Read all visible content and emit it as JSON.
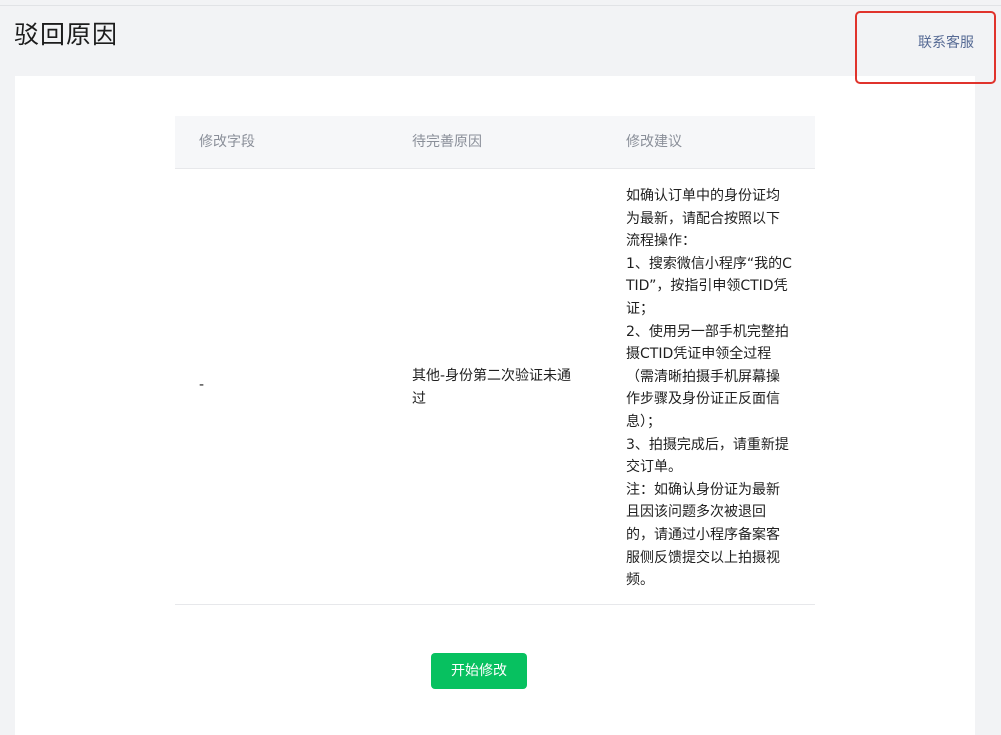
{
  "header": {
    "title": "驳回原因",
    "contact_link": "联系客服"
  },
  "table": {
    "columns": [
      "修改字段",
      "待完善原因",
      "修改建议"
    ],
    "rows": [
      {
        "field": "-",
        "reason_lines": [
          "其他-身份第二次验证未通",
          "过"
        ],
        "suggestion_lines": [
          "如确认订单中的身份证均",
          "为最新，请配合按照以下",
          "流程操作：",
          "1、搜索微信小程序“我的C",
          "TID”，按指引申领CTID凭",
          "证；",
          "2、使用另一部手机完整拍",
          "摄CTID凭证申领全过程",
          "（需清晰拍摄手机屏幕操",
          "作步骤及身份证正反面信",
          "息）；",
          "3、拍摄完成后，请重新提",
          "交订单。",
          "注：如确认身份证为最新",
          "且因该问题多次被退回",
          "的，请通过小程序备案客",
          "服侧反馈提交以上拍摄视",
          "频。"
        ]
      }
    ]
  },
  "actions": {
    "start_label": "开始修改"
  },
  "colors": {
    "primary_green": "#07c160",
    "link_blue": "#576b95",
    "highlight_red": "#e0332c",
    "page_background": "#f2f3f5"
  }
}
